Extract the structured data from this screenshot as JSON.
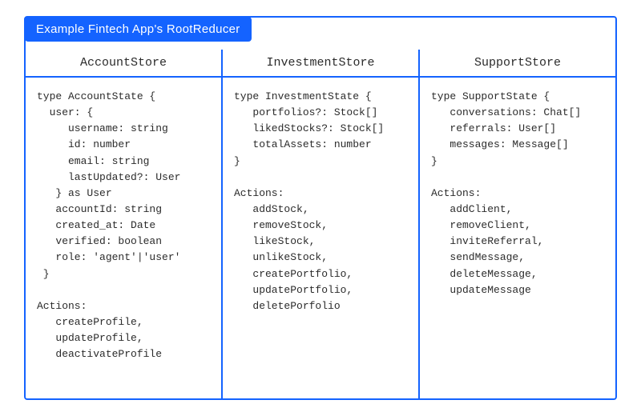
{
  "title": "Example  Fintech App's RootReducer",
  "columns": [
    {
      "header": "AccountStore",
      "body": "type AccountState {\n  user: {\n     username: string\n     id: number\n     email: string\n     lastUpdated?: User\n   } as User\n   accountId: string\n   created_at: Date\n   verified: boolean\n   role: 'agent'|'user'\n }\n\nActions:\n   createProfile,\n   updateProfile,\n   deactivateProfile"
    },
    {
      "header": "InvestmentStore",
      "body": "type InvestmentState {\n   portfolios?: Stock[]\n   likedStocks?: Stock[]\n   totalAssets: number\n}\n\nActions:\n   addStock,\n   removeStock,\n   likeStock,\n   unlikeStock,\n   createPortfolio,\n   updatePortfolio,\n   deletePorfolio"
    },
    {
      "header": "SupportStore",
      "body": "type SupportState {\n   conversations: Chat[]\n   referrals: User[]\n   messages: Message[]\n}\n\nActions:\n   addClient,\n   removeClient,\n   inviteReferral,\n   sendMessage,\n   deleteMessage,\n   updateMessage"
    }
  ]
}
